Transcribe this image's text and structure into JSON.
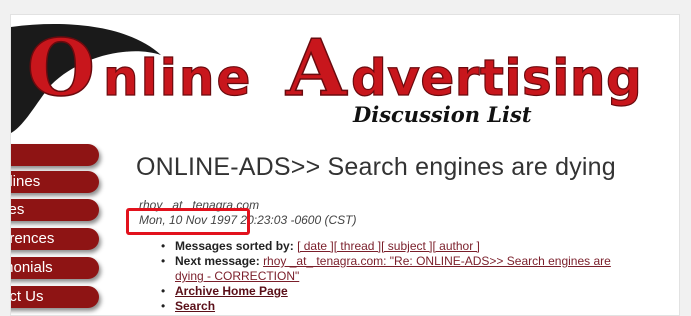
{
  "banner": {
    "title_line1_initial": "O",
    "title_line1_rest": "nline",
    "title_line2_initial": "A",
    "title_line2_rest": "dvertising",
    "subtitle": "Discussion List"
  },
  "sidebar": {
    "items": [
      {
        "label": "e"
      },
      {
        "label": "elines"
      },
      {
        "label": "ves"
      },
      {
        "label": "erences"
      },
      {
        "label": "monials"
      },
      {
        "label": "act Us"
      }
    ]
  },
  "message": {
    "subject": "ONLINE-ADS>> Search engines are dying",
    "author": "rhoy _at_ tenagra.com",
    "date": "Mon, 10 Nov 1997",
    "time": "20:23:03 -0600 (CST)"
  },
  "nav": {
    "sorted_label": "Messages sorted by:",
    "sort_links": [
      "[ date ]",
      "[ thread ]",
      "[ subject ]",
      "[ author ]"
    ],
    "next_label": "Next message:",
    "next_link_line1": "rhoy _at_ tenagra.com: \"Re: ONLINE-ADS>> Search engines are",
    "next_link_line2": "dying - CORRECTION\"",
    "archive_link": "Archive Home Page",
    "search_link": "Search"
  },
  "colors": {
    "logo_red": "#c8161c",
    "logo_dark": "#1a1a1a",
    "nav_maroon": "#8e1414",
    "highlight_red": "#e2121d"
  }
}
